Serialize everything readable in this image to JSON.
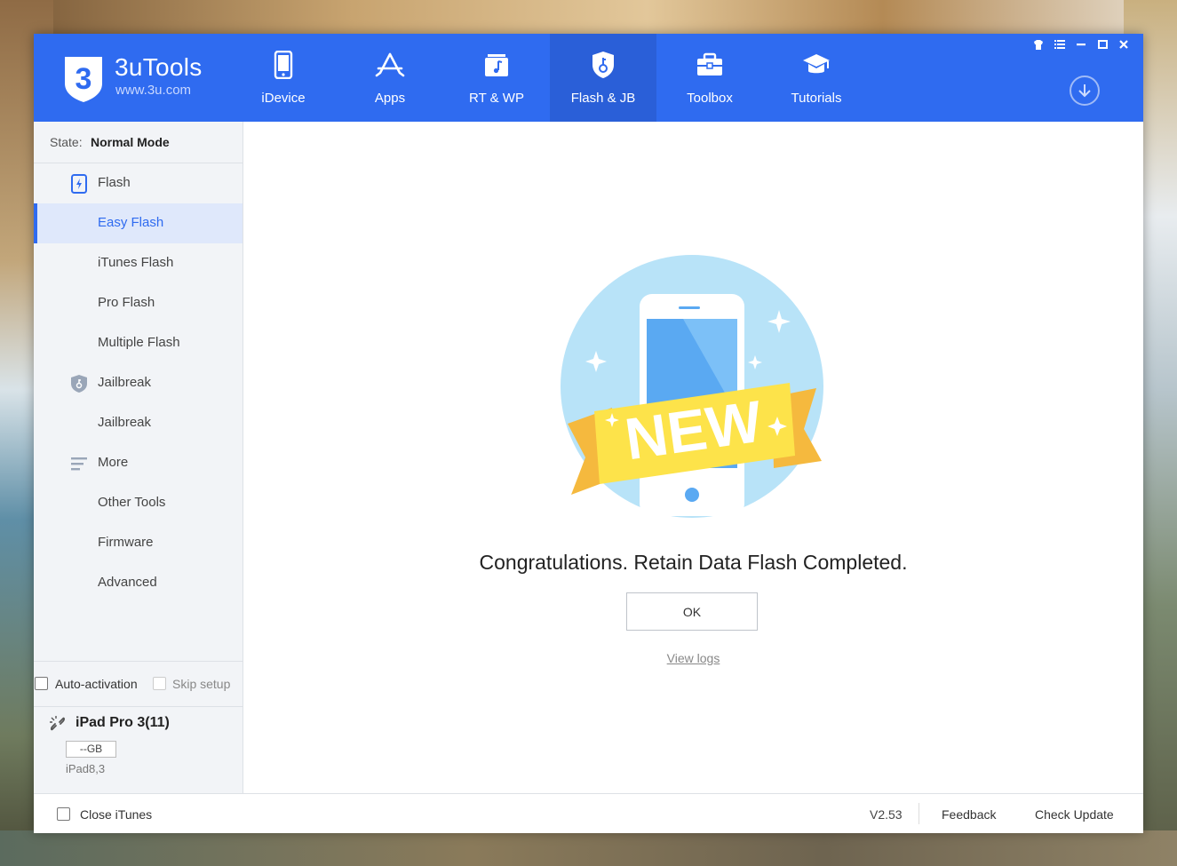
{
  "app": {
    "name": "3uTools",
    "logo_glyph": "3",
    "website": "www.3u.com",
    "accent_color": "#2f6bf0"
  },
  "nav": [
    {
      "label": "iDevice",
      "icon": "phone-icon"
    },
    {
      "label": "Apps",
      "icon": "app-store-icon"
    },
    {
      "label": "RT & WP",
      "icon": "ringtone-icon"
    },
    {
      "label": "Flash & JB",
      "icon": "shield-key-icon",
      "active": true
    },
    {
      "label": "Toolbox",
      "icon": "toolbox-icon"
    },
    {
      "label": "Tutorials",
      "icon": "graduation-cap-icon"
    }
  ],
  "window_controls": [
    "shirt-icon",
    "list-icon",
    "minimize-icon",
    "maximize-icon",
    "close-icon"
  ],
  "sidebar": {
    "state_label": "State:",
    "state_value": "Normal Mode",
    "items": [
      {
        "label": "Flash",
        "section": true,
        "icon": "flash-tablet-icon"
      },
      {
        "label": "Easy Flash",
        "active": true
      },
      {
        "label": "iTunes Flash"
      },
      {
        "label": "Pro Flash"
      },
      {
        "label": "Multiple Flash"
      },
      {
        "label": "Jailbreak",
        "section": true,
        "icon": "shield-icon"
      },
      {
        "label": "Jailbreak"
      },
      {
        "label": "More",
        "section": true,
        "icon": "menu-lines-icon"
      },
      {
        "label": "Other Tools"
      },
      {
        "label": "Firmware"
      },
      {
        "label": "Advanced"
      }
    ],
    "auto_activation_label": "Auto-activation",
    "skip_setup_label": "Skip setup",
    "device": {
      "name": "iPad Pro 3(11)",
      "capacity": "--GB",
      "model": "iPad8,3"
    }
  },
  "main": {
    "banner_text": "NEW",
    "message": "Congratulations. Retain Data Flash Completed.",
    "ok_label": "OK",
    "logs_label": "View logs"
  },
  "footer": {
    "close_itunes_label": "Close iTunes",
    "version": "V2.53",
    "feedback_label": "Feedback",
    "check_update_label": "Check Update"
  }
}
